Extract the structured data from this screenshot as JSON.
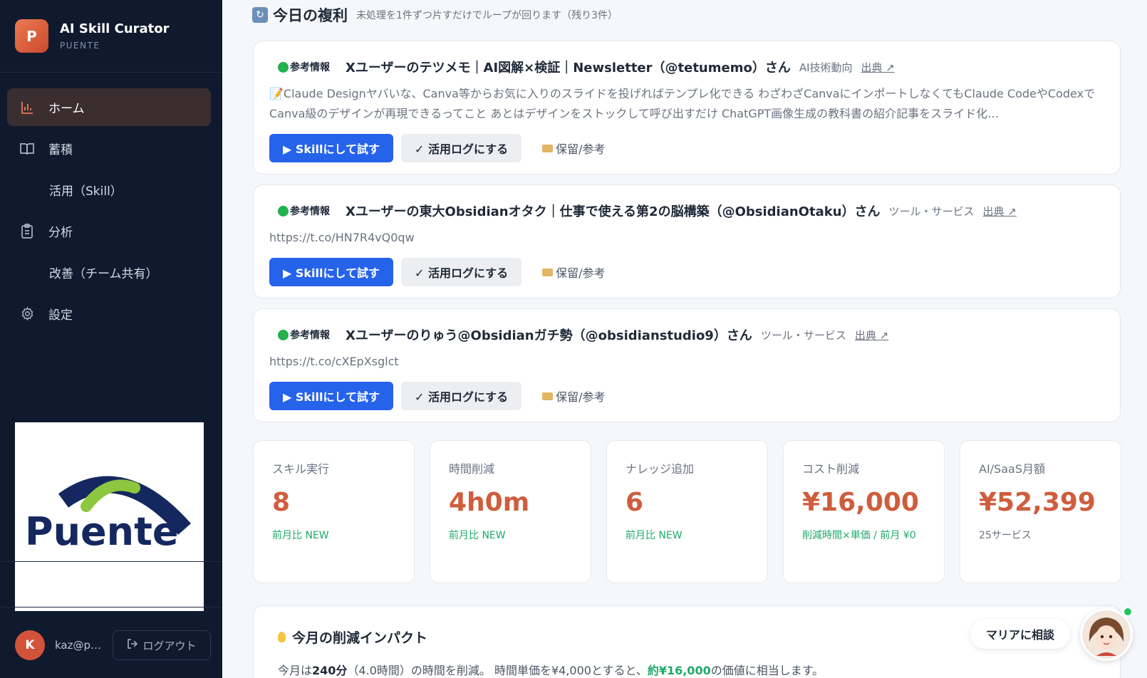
{
  "brand": {
    "logo_letter": "P",
    "name": "AI Skill Curator",
    "sub": "PUENTE"
  },
  "nav": [
    {
      "label": "ホーム",
      "icon": "chart-icon",
      "active": true
    },
    {
      "label": "蓄積",
      "icon": "book-icon"
    },
    {
      "label": "活用（Skill）",
      "icon": ""
    },
    {
      "label": "分析",
      "icon": "clipboard-icon"
    },
    {
      "label": "改善（チーム共有）",
      "icon": ""
    },
    {
      "label": "設定",
      "icon": "gear-icon"
    }
  ],
  "logo_image": {
    "alt": "Puente logo"
  },
  "user": {
    "avatar_letter": "K",
    "email": "kaz@p…",
    "logout_label": "ログアウト"
  },
  "section": {
    "title": "今日の複利",
    "subtitle": "未処理を1件ずつ片すだけでループが回ります（残り3件）"
  },
  "cards": [
    {
      "tag": "参考情報",
      "title": "Xユーザーのテツメモ｜AI図解×検証｜Newsletter（@tetumemo）さん",
      "category": "AI技術動向",
      "source": "出典 ↗",
      "body": "📝Claude Designヤバいな、Canva等からお気に入りのスライドを投げればテンプレ化できる わざわざCanvaにインポートしなくてもClaude CodeやCodexでCanva級のデザインが再現できるってこと あとはデザインをストックして呼び出すだけ ChatGPT画像生成の教科書の紹介記事をスライド化…",
      "try_label": "▶ Skillにして試す",
      "log_label": "✓ 活用ログにする",
      "hold_label": "保留/参考"
    },
    {
      "tag": "参考情報",
      "title": "Xユーザーの東大Obsidianオタク｜仕事で使える第2の脳構築（@ObsidianOtaku）さん",
      "category": "ツール・サービス",
      "source": "出典 ↗",
      "body": "https://t.co/HN7R4vQ0qw",
      "try_label": "▶ Skillにして試す",
      "log_label": "✓ 活用ログにする",
      "hold_label": "保留/参考"
    },
    {
      "tag": "参考情報",
      "title": "Xユーザーのりゅう@Obsidianガチ勢（@obsidianstudio9）さん",
      "category": "ツール・サービス",
      "source": "出典 ↗",
      "body": "https://t.co/cXEpXsglct",
      "try_label": "▶ Skillにして試す",
      "log_label": "✓ 活用ログにする",
      "hold_label": "保留/参考"
    }
  ],
  "stats": [
    {
      "label": "スキル実行",
      "value": "8",
      "note": "前月比 NEW"
    },
    {
      "label": "時間削減",
      "value": "4h0m",
      "note": "前月比 NEW"
    },
    {
      "label": "ナレッジ追加",
      "value": "6",
      "note": "前月比 NEW"
    },
    {
      "label": "コスト削減",
      "value": "¥16,000",
      "note": "削減時間×単価 / 前月 ¥0"
    },
    {
      "label": "AI/SaaS月額",
      "value": "¥52,399",
      "note": "25サービス"
    }
  ],
  "impact": {
    "title": "今月の削減インパクト",
    "t1": "今月は",
    "minutes": "240分",
    "t2": "（4.0時間）の時間を削減。 時間単価を¥4,000とすると、",
    "value": "約¥16,000",
    "t3": "の価値に相当します。"
  },
  "consult": {
    "label": "マリアに相談"
  },
  "colors": {
    "accent": "#cf5d3d",
    "primary": "#2563eb",
    "positive": "#1faa6b",
    "sidebar": "#0f1a2e"
  }
}
